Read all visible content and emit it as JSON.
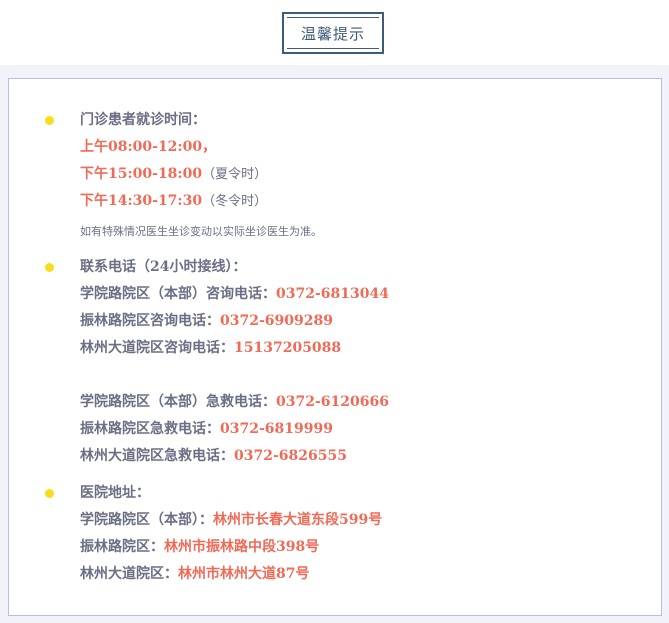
{
  "header": {
    "title": "温馨提示"
  },
  "hours": {
    "heading": "门诊患者就诊时间：",
    "morning": "上午08:00-12:00，",
    "afternoon_summer_time": "下午15:00-18:00",
    "afternoon_summer_note": "（夏令时）",
    "afternoon_winter_time": "下午14:30-17:30",
    "afternoon_winter_note": "（冬令时）",
    "note": "如有特殊情况医生坐诊变动以实际坐诊医生为准。"
  },
  "contact": {
    "heading": "联系电话（24小时接线）：",
    "consult": [
      {
        "label": "学院路院区（本部）咨询电话：",
        "value": "0372-6813044"
      },
      {
        "label": "振林路院区咨询电话：",
        "value": "0372-6909289"
      },
      {
        "label": "林州大道院区咨询电话：",
        "value": "15137205088"
      }
    ],
    "emergency": [
      {
        "label": "学院路院区（本部）急救电话：",
        "value": "0372-6120666"
      },
      {
        "label": "振林路院区急救电话：",
        "value": "0372-6819999"
      },
      {
        "label": "林州大道院区急救电话：",
        "value": "0372-6826555"
      }
    ]
  },
  "address": {
    "heading": "医院地址：",
    "items": [
      {
        "label": "学院路院区（本部）：",
        "value": "林州市长春大道东段599号"
      },
      {
        "label": "振林路院区：",
        "value": "林州市振林路中段398号"
      },
      {
        "label": "林州大道院区：",
        "value": "林州市林州大道87号"
      }
    ]
  },
  "colors": {
    "accent_red": "#f06a56",
    "bullet_yellow": "#f6de1c",
    "frame_blue": "#3e5b79",
    "panel_border": "#b9bce3"
  }
}
